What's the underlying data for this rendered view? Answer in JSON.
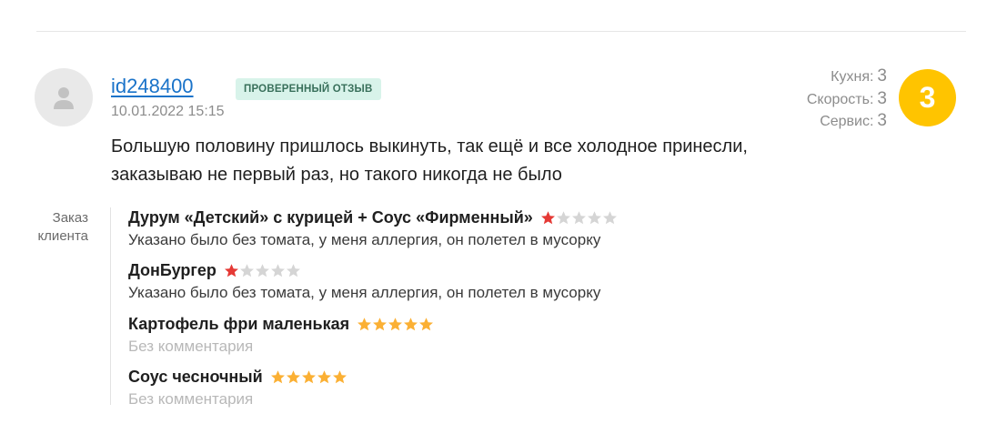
{
  "review": {
    "username": "id248400",
    "badge": "ПРОВЕРЕННЫЙ ОТЗЫВ",
    "date": "10.01.2022 15:15",
    "text": "Большую половину пришлось выкинуть, так ещё и все холодное принесли, заказываю не первый раз, но такого никогда не было"
  },
  "scores": {
    "kitchen_label": "Кухня:",
    "kitchen": "3",
    "speed_label": "Скорость:",
    "speed": "3",
    "service_label": "Сервис:",
    "service": "3",
    "overall": "3"
  },
  "order": {
    "label": "Заказ клиента",
    "items": [
      {
        "name": "Дурум «Детский» с курицей + Соус «Фирменный»",
        "rating": 1,
        "comment": "Указано было без томата, у меня аллергия, он полетел в мусорку"
      },
      {
        "name": "ДонБургер",
        "rating": 1,
        "comment": "Указано было без томата, у меня аллергия, он полетел в мусорку"
      },
      {
        "name": "Картофель фри маленькая",
        "rating": 5,
        "comment": "Без комментария"
      },
      {
        "name": "Соус чесночный",
        "rating": 5,
        "comment": "Без комментария"
      }
    ]
  },
  "colors": {
    "star_low": "#e53935",
    "star_high": "#fbb034",
    "star_empty": "#d5d5d5",
    "overall_bg": "#ffc400",
    "link": "#1a73c9"
  }
}
